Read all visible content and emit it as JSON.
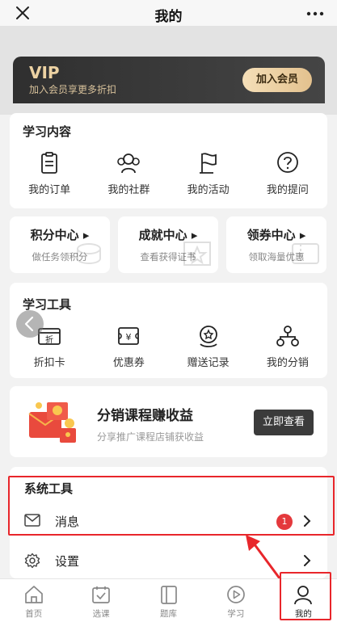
{
  "header": {
    "title": "我的"
  },
  "vip": {
    "title": "VIP",
    "subtitle": "加入会员享更多折扣",
    "button": "加入会员"
  },
  "learning_content": {
    "title": "学习内容",
    "items": [
      {
        "label": "我的订单",
        "icon": "clipboard-icon"
      },
      {
        "label": "我的社群",
        "icon": "group-icon"
      },
      {
        "label": "我的活动",
        "icon": "flag-icon"
      },
      {
        "label": "我的提问",
        "icon": "question-icon"
      }
    ]
  },
  "centers": [
    {
      "title": "积分中心",
      "subtitle": "做任务领积分"
    },
    {
      "title": "成就中心",
      "subtitle": "查看获得证书"
    },
    {
      "title": "领券中心",
      "subtitle": "领取海量优惠"
    }
  ],
  "learning_tools": {
    "title": "学习工具",
    "items": [
      {
        "label": "折扣卡",
        "icon": "discount-card-icon",
        "glyph": "折"
      },
      {
        "label": "优惠券",
        "icon": "coupon-icon",
        "glyph": "¥"
      },
      {
        "label": "赠送记录",
        "icon": "gift-record-icon"
      },
      {
        "label": "我的分销",
        "icon": "distribution-icon"
      }
    ]
  },
  "promo": {
    "title": "分销课程赚收益",
    "subtitle": "分享推广课程店铺获收益",
    "button": "立即查看"
  },
  "system_tools": {
    "title": "系统工具",
    "message_label": "消息",
    "message_badge": "1",
    "settings_label": "设置"
  },
  "tabbar": [
    {
      "label": "首页",
      "icon": "home-icon"
    },
    {
      "label": "选课",
      "icon": "course-select-icon"
    },
    {
      "label": "题库",
      "icon": "question-bank-icon"
    },
    {
      "label": "学习",
      "icon": "play-icon"
    },
    {
      "label": "我的",
      "icon": "user-icon",
      "active": true
    }
  ],
  "colors": {
    "accent": "#e4393c",
    "highlight": "#e8262b",
    "vip_gold": "#ecd2a3"
  }
}
